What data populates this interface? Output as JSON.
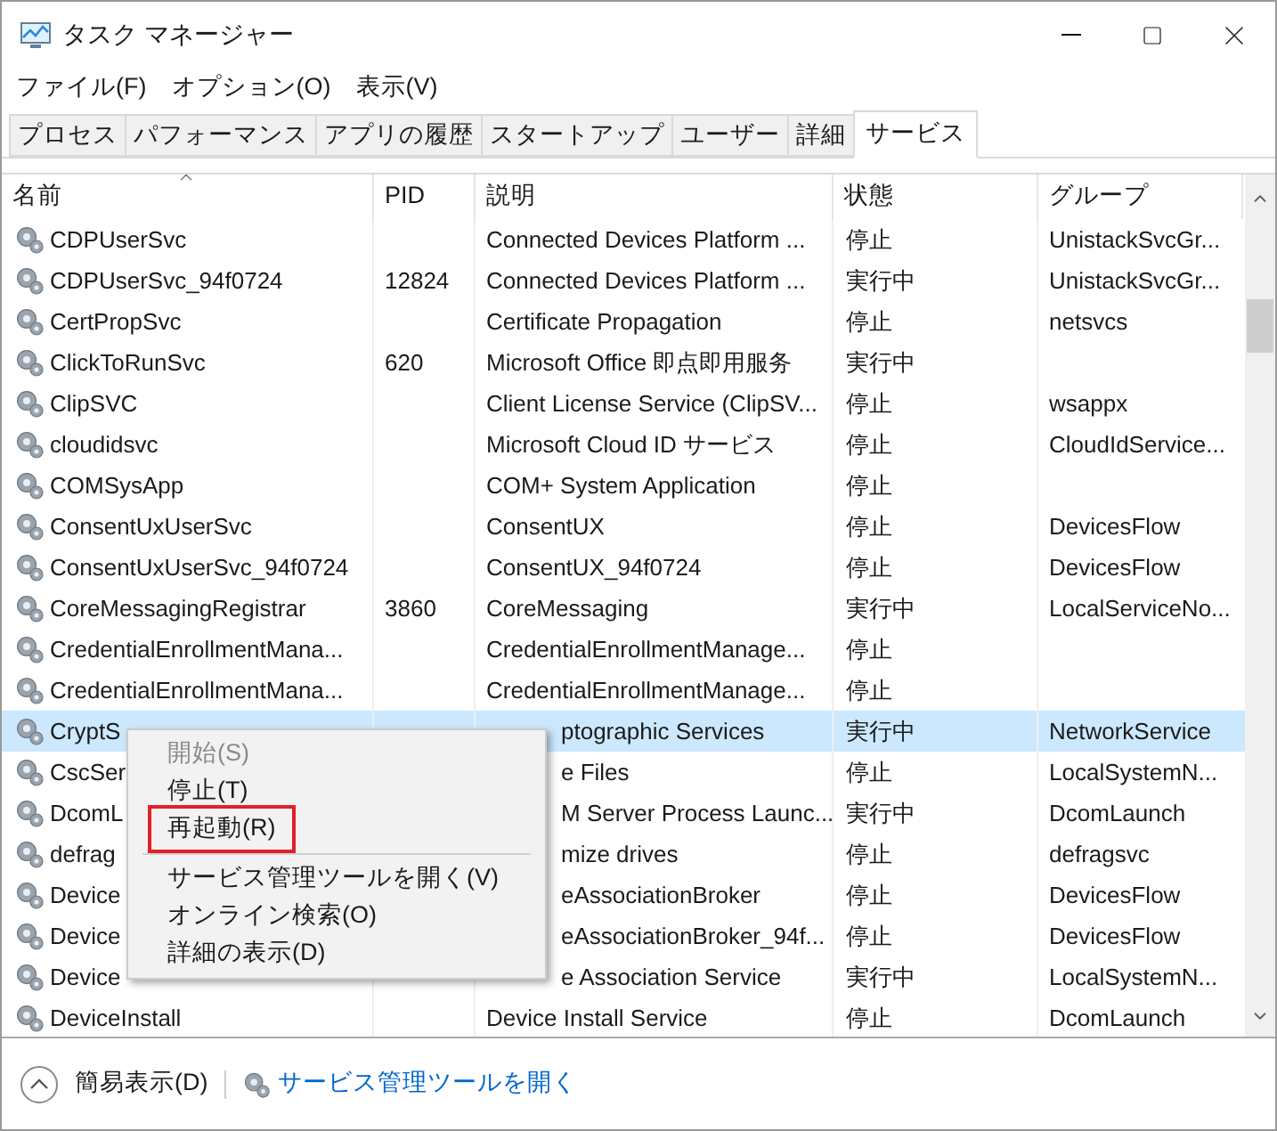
{
  "window": {
    "title": "タスク マネージャー"
  },
  "menu_bar": [
    "ファイル(F)",
    "オプション(O)",
    "表示(V)"
  ],
  "tabs": [
    {
      "label": "プロセス",
      "selected": false
    },
    {
      "label": "パフォーマンス",
      "selected": false
    },
    {
      "label": "アプリの履歴",
      "selected": false
    },
    {
      "label": "スタートアップ",
      "selected": false
    },
    {
      "label": "ユーザー",
      "selected": false
    },
    {
      "label": "詳細",
      "selected": false
    },
    {
      "label": "サービス",
      "selected": true
    }
  ],
  "table": {
    "columns": [
      {
        "label": "名前",
        "sorted": true
      },
      {
        "label": "PID",
        "sorted": false
      },
      {
        "label": "説明",
        "sorted": false
      },
      {
        "label": "状態",
        "sorted": false
      },
      {
        "label": "グループ",
        "sorted": false
      }
    ],
    "rows": [
      {
        "name": "CDPUserSvc",
        "pid": "",
        "description": "Connected Devices Platform ...",
        "status": "停止",
        "group": "UnistackSvcGr...",
        "selected": false
      },
      {
        "name": "CDPUserSvc_94f0724",
        "pid": "12824",
        "description": "Connected Devices Platform ...",
        "status": "実行中",
        "group": "UnistackSvcGr...",
        "selected": false
      },
      {
        "name": "CertPropSvc",
        "pid": "",
        "description": "Certificate Propagation",
        "status": "停止",
        "group": "netsvcs",
        "selected": false
      },
      {
        "name": "ClickToRunSvc",
        "pid": "620",
        "description": "Microsoft Office 即点即用服务",
        "status": "実行中",
        "group": "",
        "selected": false
      },
      {
        "name": "ClipSVC",
        "pid": "",
        "description": "Client License Service (ClipSV...",
        "status": "停止",
        "group": "wsappx",
        "selected": false
      },
      {
        "name": "cloudidsvc",
        "pid": "",
        "description": "Microsoft Cloud ID サービス",
        "status": "停止",
        "group": "CloudIdService...",
        "selected": false
      },
      {
        "name": "COMSysApp",
        "pid": "",
        "description": "COM+ System Application",
        "status": "停止",
        "group": "",
        "selected": false
      },
      {
        "name": "ConsentUxUserSvc",
        "pid": "",
        "description": "ConsentUX",
        "status": "停止",
        "group": "DevicesFlow",
        "selected": false
      },
      {
        "name": "ConsentUxUserSvc_94f0724",
        "pid": "",
        "description": "ConsentUX_94f0724",
        "status": "停止",
        "group": "DevicesFlow",
        "selected": false
      },
      {
        "name": "CoreMessagingRegistrar",
        "pid": "3860",
        "description": "CoreMessaging",
        "status": "実行中",
        "group": "LocalServiceNo...",
        "selected": false
      },
      {
        "name": "CredentialEnrollmentMana...",
        "pid": "",
        "description": "CredentialEnrollmentManage...",
        "status": "停止",
        "group": "",
        "selected": false
      },
      {
        "name": "CredentialEnrollmentMana...",
        "pid": "",
        "description": "CredentialEnrollmentManage...",
        "status": "停止",
        "group": "",
        "selected": false
      },
      {
        "name": "CryptS",
        "pid": "",
        "description": "ptographic Services",
        "status": "実行中",
        "group": "NetworkService",
        "selected": true
      },
      {
        "name": "CscSer",
        "pid": "",
        "description": "e Files",
        "status": "停止",
        "group": "LocalSystemN...",
        "selected": false
      },
      {
        "name": "DcomL",
        "pid": "",
        "description": "M Server Process Launc...",
        "status": "実行中",
        "group": "DcomLaunch",
        "selected": false
      },
      {
        "name": "defrag",
        "pid": "",
        "description": "mize drives",
        "status": "停止",
        "group": "defragsvc",
        "selected": false
      },
      {
        "name": "Device",
        "pid": "",
        "description": "eAssociationBroker",
        "status": "停止",
        "group": "DevicesFlow",
        "selected": false
      },
      {
        "name": "Device",
        "pid": "",
        "description": "eAssociationBroker_94f...",
        "status": "停止",
        "group": "DevicesFlow",
        "selected": false
      },
      {
        "name": "Device",
        "pid": "",
        "description": "e Association Service",
        "status": "実行中",
        "group": "LocalSystemN...",
        "selected": false
      },
      {
        "name": "DeviceInstall",
        "pid": "",
        "description": "Device Install Service",
        "status": "停止",
        "group": "DcomLaunch",
        "selected": false
      }
    ]
  },
  "context_menu": {
    "items": [
      {
        "kind": "item",
        "label": "開始(S)",
        "disabled": true,
        "outlined": false
      },
      {
        "kind": "item",
        "label": "停止(T)",
        "disabled": false,
        "outlined": false
      },
      {
        "kind": "item",
        "label": "再起動(R)",
        "disabled": false,
        "outlined": true
      },
      {
        "kind": "separator"
      },
      {
        "kind": "item",
        "label": "サービス管理ツールを開く(V)",
        "disabled": false,
        "outlined": false
      },
      {
        "kind": "item",
        "label": "オンライン検索(O)",
        "disabled": false,
        "outlined": false
      },
      {
        "kind": "item",
        "label": "詳細の表示(D)",
        "disabled": false,
        "outlined": false
      }
    ]
  },
  "footer": {
    "toggle": "簡易表示(D)",
    "link": "サービス管理ツールを開く"
  }
}
